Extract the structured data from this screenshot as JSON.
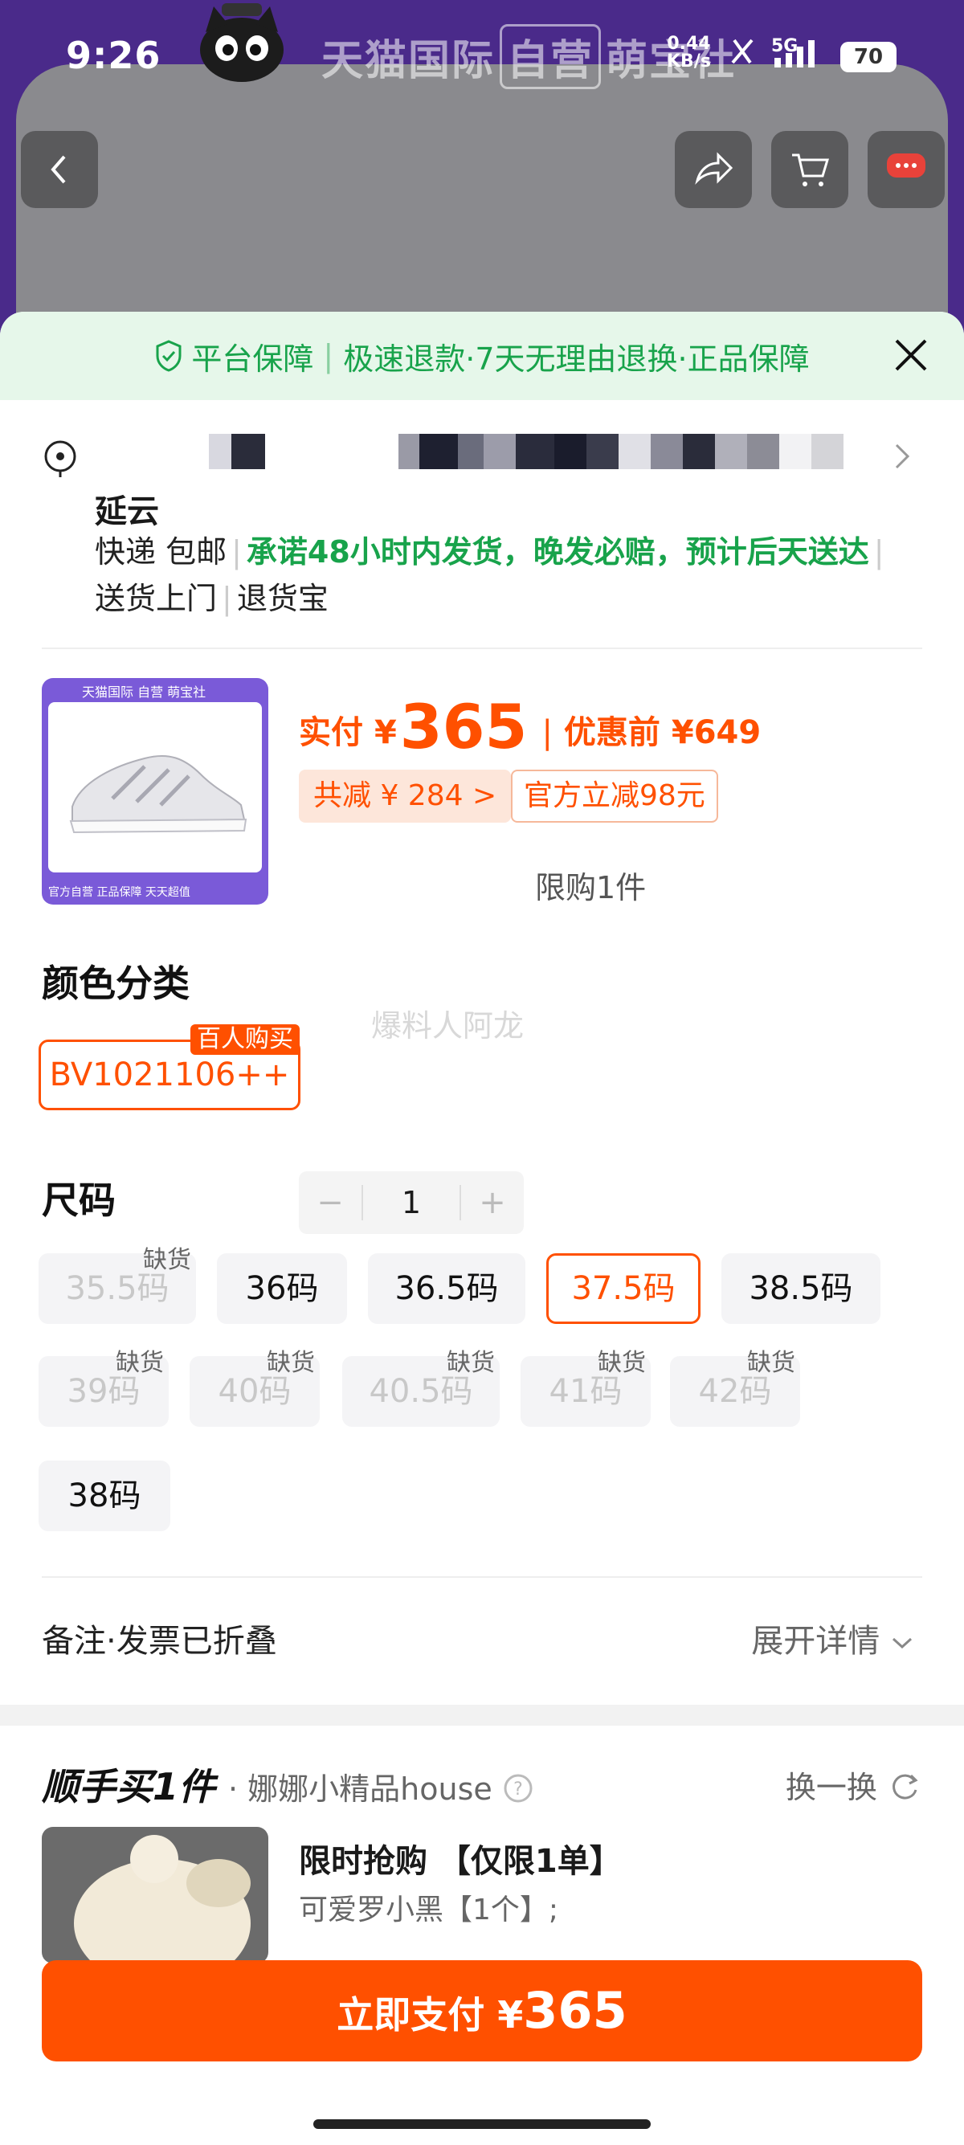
{
  "status": {
    "time": "9:26",
    "net_speed": "0.44",
    "net_unit": "KB/s",
    "network": "5G",
    "battery": "70"
  },
  "banner": {
    "brand_left": "天猫国际",
    "brand_box": "自营",
    "brand_right": "萌宝社"
  },
  "guarantee": {
    "item1": "平台保障",
    "item2": "极速退款·7天无理由退换·正品保障"
  },
  "address": {
    "name": "延云",
    "delivery_method": "快递 包邮",
    "promise": "承诺48小时内发货，晚发必赔，预计后天送达",
    "service1": "送货上门",
    "service2": "退货宝"
  },
  "product": {
    "thumb_header": "天猫国际 自营 萌宝社",
    "thumb_footer": "官方自营  正品保障  天天超值",
    "pay_label": "实付",
    "currency": "¥",
    "pay_amount": "365",
    "before_label": "优惠前",
    "before_price": "¥649",
    "discount": "共减 ¥ 284 >",
    "official_discount": "官方立减98元",
    "quantity": "1",
    "minus": "−",
    "plus": "+",
    "limit": "限购1件"
  },
  "color_section": {
    "title": "颜色分类",
    "option": "BV1021106++",
    "hot_tag": "百人购买",
    "watermark": "爆料人阿龙"
  },
  "size_section": {
    "title": "尺码",
    "out_tag": "缺货",
    "sizes": [
      "35.5码",
      "36码",
      "36.5码",
      "37.5码",
      "38.5码",
      "39码",
      "40码",
      "40.5码",
      "41码",
      "42码",
      "38码"
    ],
    "selected": "37.5码",
    "out_of_stock": [
      "35.5码",
      "39码",
      "40码",
      "40.5码",
      "41码",
      "42码"
    ]
  },
  "remark": {
    "label": "备注·发票已折叠",
    "expand": "展开详情"
  },
  "add_on": {
    "title": "顺手买1件",
    "shop": "· 娜娜小精品house",
    "swap": "换一换",
    "item_title": "限时抢购 【仅限1单】",
    "item_desc": "可爱罗小黑【1个】;"
  },
  "checkout": {
    "label": "立即支付 ¥",
    "amount": "365"
  },
  "colors": {
    "accent": "#ff5000",
    "green": "#18a34b",
    "purple": "#4a2a8a"
  }
}
